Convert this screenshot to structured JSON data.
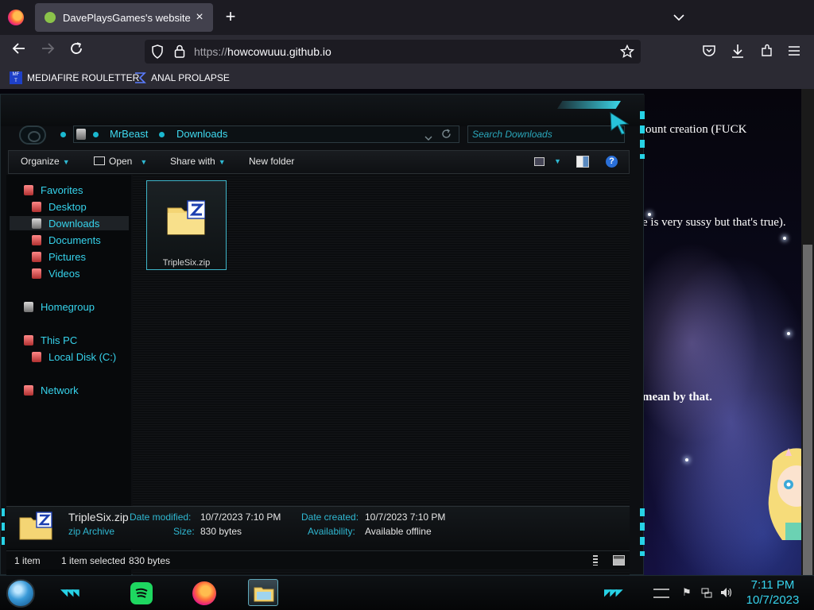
{
  "browser": {
    "tab_title": "DavePlaysGames's website",
    "tab_close": "×",
    "new_tab": "+",
    "url_scheme": "https://",
    "url_host": "howcowuuu.github.io",
    "bookmarks": [
      {
        "label": "MEDIAFIRE ROULETTER",
        "icon": "mediafire-icon"
      },
      {
        "label": "ANAL PROLAPSE",
        "icon": "bookmark-sigma-icon"
      }
    ]
  },
  "webpage": {
    "lines": [
      "ount creation (FUCK",
      "e is very sussy but that's true).",
      "mean by that."
    ]
  },
  "explorer": {
    "breadcrumb": [
      "MrBeast",
      "Downloads"
    ],
    "search_placeholder": "Search Downloads",
    "toolbar": {
      "organize": "Organize",
      "open": "Open",
      "share_with": "Share with",
      "new_folder": "New folder"
    },
    "nav": {
      "favorites": "Favorites",
      "desktop": "Desktop",
      "downloads": "Downloads",
      "documents": "Documents",
      "pictures": "Pictures",
      "videos": "Videos",
      "homegroup": "Homegroup",
      "this_pc": "This PC",
      "local_disk": "Local Disk (C:)",
      "network": "Network"
    },
    "files": [
      {
        "name": "TripleSix.zip",
        "icon": "zip-archive-icon"
      }
    ],
    "details": {
      "name": "TripleSix.zip",
      "type": "zip Archive",
      "date_modified_label": "Date modified:",
      "date_modified": "10/7/2023 7:10 PM",
      "size_label": "Size:",
      "size": "830 bytes",
      "date_created_label": "Date created:",
      "date_created": "10/7/2023 7:10 PM",
      "availability_label": "Availability:",
      "availability": "Available offline"
    },
    "status": {
      "count": "1 item",
      "selected": "1 item selected",
      "selected_size": "830 bytes"
    }
  },
  "taskbar": {
    "apps": [
      "spotify-icon",
      "firefox-icon",
      "file-explorer-icon"
    ],
    "time": "7:11 PM",
    "date": "10/7/2023"
  },
  "colors": {
    "accent": "#36d3ec",
    "explorer_bg": "#0d0f12",
    "browser_bar": "#2b2a33"
  }
}
